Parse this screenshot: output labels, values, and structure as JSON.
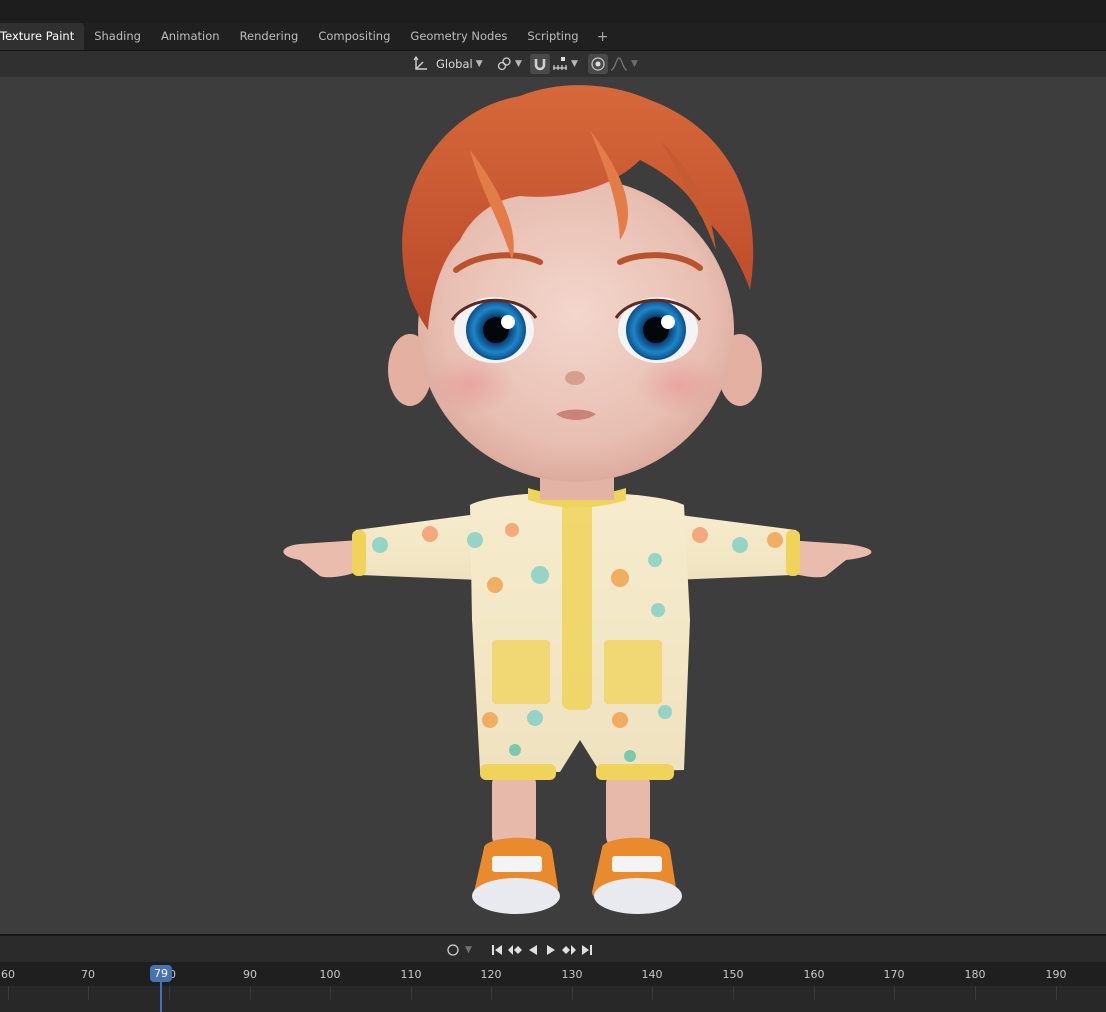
{
  "workspace_tabs": [
    {
      "label": "Texture Paint"
    },
    {
      "label": "Shading"
    },
    {
      "label": "Animation"
    },
    {
      "label": "Rendering"
    },
    {
      "label": "Compositing"
    },
    {
      "label": "Geometry Nodes"
    },
    {
      "label": "Scripting"
    }
  ],
  "add_tab_glyph": "+",
  "viewport_header": {
    "transform_orientation": "Global",
    "transform_icon": "orientation-axes-icon",
    "pivot_icon": "pivot-link-icon",
    "snap_icon": "magnet-snap-icon",
    "snap_target_icon": "snap-increment-icon",
    "proportional_icon": "proportional-edit-icon",
    "falloff_icon": "falloff-curve-icon"
  },
  "timeline": {
    "current_frame": "79",
    "ruler_labels": [
      "60",
      "70",
      "80",
      "90",
      "100",
      "110",
      "120",
      "130",
      "140",
      "150",
      "160",
      "170",
      "180",
      "190"
    ],
    "playback_icons": [
      "record-icon",
      "jump-to-start-icon",
      "prev-keyframe-icon",
      "play-reverse-icon",
      "play-icon",
      "next-keyframe-icon",
      "jump-to-end-icon"
    ]
  },
  "colors": {
    "accent": "#4772b3",
    "viewport_bg": "#3d3d3d",
    "header_bg": "#303030"
  }
}
